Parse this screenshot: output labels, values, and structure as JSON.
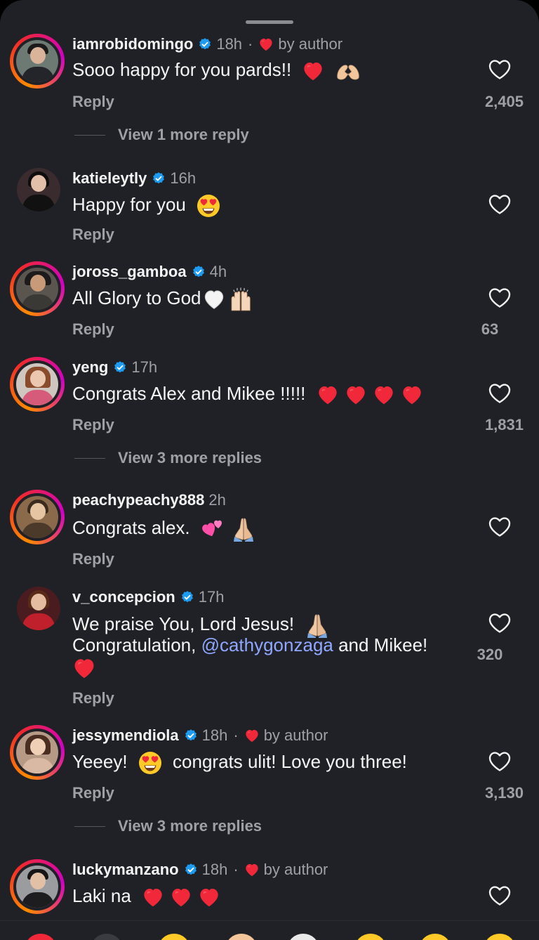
{
  "comments": [
    {
      "username": "iamrobidomingo",
      "time": "18h",
      "by_author": "by author",
      "text": "Sooo happy for you pards!!",
      "reply": "Reply",
      "likes": "2,405",
      "view_more": "View 1 more reply"
    },
    {
      "username": "katieleytly",
      "time": "16h",
      "text": "Happy for you",
      "reply": "Reply"
    },
    {
      "username": "joross_gamboa",
      "time": "4h",
      "text": "All Glory to God",
      "reply": "Reply",
      "likes": "63"
    },
    {
      "username": "yeng",
      "time": "17h",
      "text": "Congrats Alex and Mikee !!!!!",
      "reply": "Reply",
      "likes": "1,831",
      "view_more": "View 3 more replies"
    },
    {
      "username": "peachypeachy888",
      "time": "2h",
      "text": "Congrats alex.",
      "reply": "Reply"
    },
    {
      "username": "v_concepcion",
      "time": "17h",
      "line1": "We praise You, Lord Jesus!",
      "line2a": "Congratulation, ",
      "mention": "@cathygonzaga",
      "line2b": " and Mikee!",
      "reply": "Reply",
      "likes": "320"
    },
    {
      "username": "jessymendiola",
      "time": "18h",
      "by_author": "by author",
      "text_a": "Yeeey!",
      "text_b": "congrats ulit! Love you three!",
      "reply": "Reply",
      "likes": "3,130",
      "view_more": "View 3 more replies"
    },
    {
      "username": "luckymanzano",
      "time": "18h",
      "by_author": "by author",
      "text": "Laki na"
    }
  ],
  "dot_separator": "·",
  "icons": [
    "verified-badge-icon",
    "heart-outline-icon",
    "red-heart-emoji",
    "heart-hands-emoji",
    "heart-eyes-emoji",
    "white-heart-emoji",
    "raised-hands-emoji",
    "two-hearts-emoji",
    "folded-hands-emoji"
  ],
  "colors": {
    "background": "#202126",
    "text": "#f5f5f5",
    "secondary": "#9ea0a6",
    "verified": "#1d9bf0",
    "heart": "#f0283a",
    "mention": "#8fa7ff"
  }
}
